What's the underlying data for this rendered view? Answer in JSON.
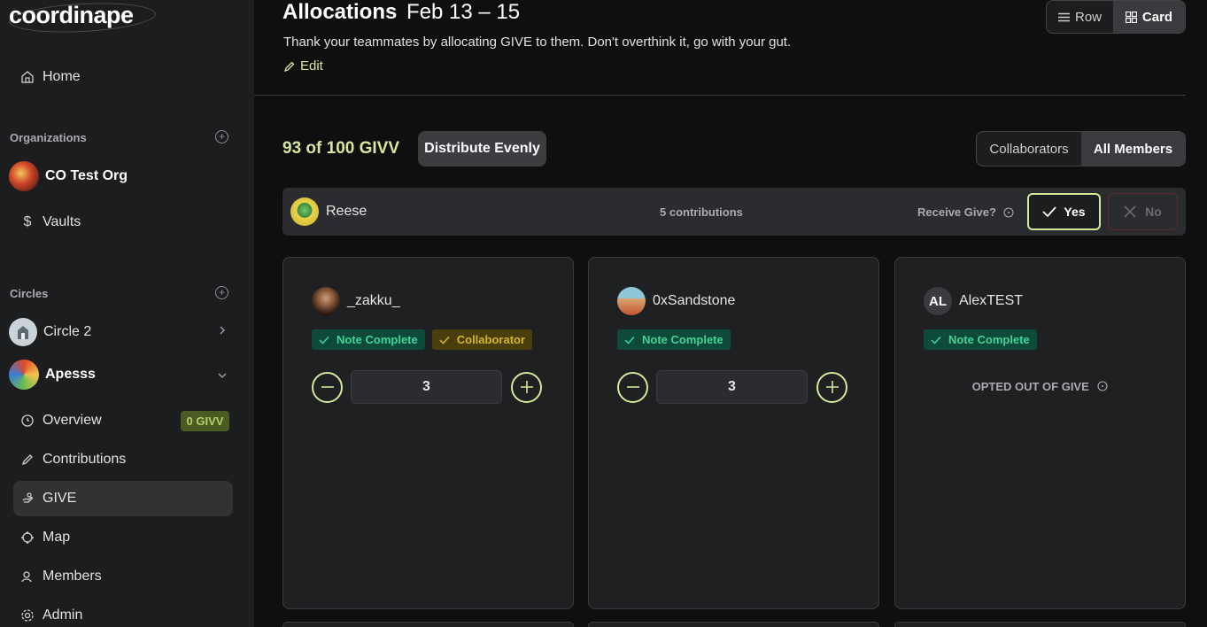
{
  "app": {
    "logo": "coordinape"
  },
  "sidebar": {
    "home_label": "Home",
    "organizations_label": "Organizations",
    "org_name": "CO Test Org",
    "vaults_label": "Vaults",
    "circles_label": "Circles",
    "circles": [
      {
        "name": "Circle 2"
      },
      {
        "name": "Apesss"
      }
    ],
    "circle_nav": [
      {
        "label": "Overview",
        "icon": "overview-icon"
      },
      {
        "label": "Contributions",
        "icon": "pencil-icon"
      },
      {
        "label": "GIVE",
        "icon": "give-icon"
      },
      {
        "label": "Map",
        "icon": "map-icon"
      },
      {
        "label": "Members",
        "icon": "members-icon"
      },
      {
        "label": "Admin",
        "icon": "gear-icon"
      }
    ],
    "overview_badge": "0 GIVV"
  },
  "header": {
    "title": "Allocations",
    "date_range": "Feb 13 – 15",
    "subtitle": "Thank your teammates by allocating GIVE to them. Don't overthink it, go with your gut.",
    "edit_label": "Edit"
  },
  "view_toggle": {
    "row_label": "Row",
    "card_label": "Card",
    "selected": "Card"
  },
  "summary": {
    "givv_status": "93 of 100 GIVV",
    "distribute_label": "Distribute Evenly"
  },
  "member_filter": {
    "collaborators_label": "Collaborators",
    "all_label": "All Members",
    "selected": "All Members"
  },
  "me": {
    "name": "Reese",
    "contributions": "5 contributions",
    "receive_label": "Receive Give?",
    "yes_label": "Yes",
    "no_label": "No"
  },
  "members": [
    {
      "name": "_zakku_",
      "tags": [
        "Note Complete",
        "Collaborator"
      ],
      "give": "3"
    },
    {
      "name": "0xSandstone",
      "tags": [
        "Note Complete"
      ],
      "give": "3"
    },
    {
      "name": "AlexTEST",
      "initials": "AL",
      "tags": [
        "Note Complete"
      ],
      "opted_out": "OPTED OUT OF GIVE"
    }
  ],
  "colors": {
    "accent": "#d6e69a",
    "note_tag": "#40d39a",
    "collab_tag": "#d4b52b",
    "sidebar_bg": "#1c1d1f"
  }
}
